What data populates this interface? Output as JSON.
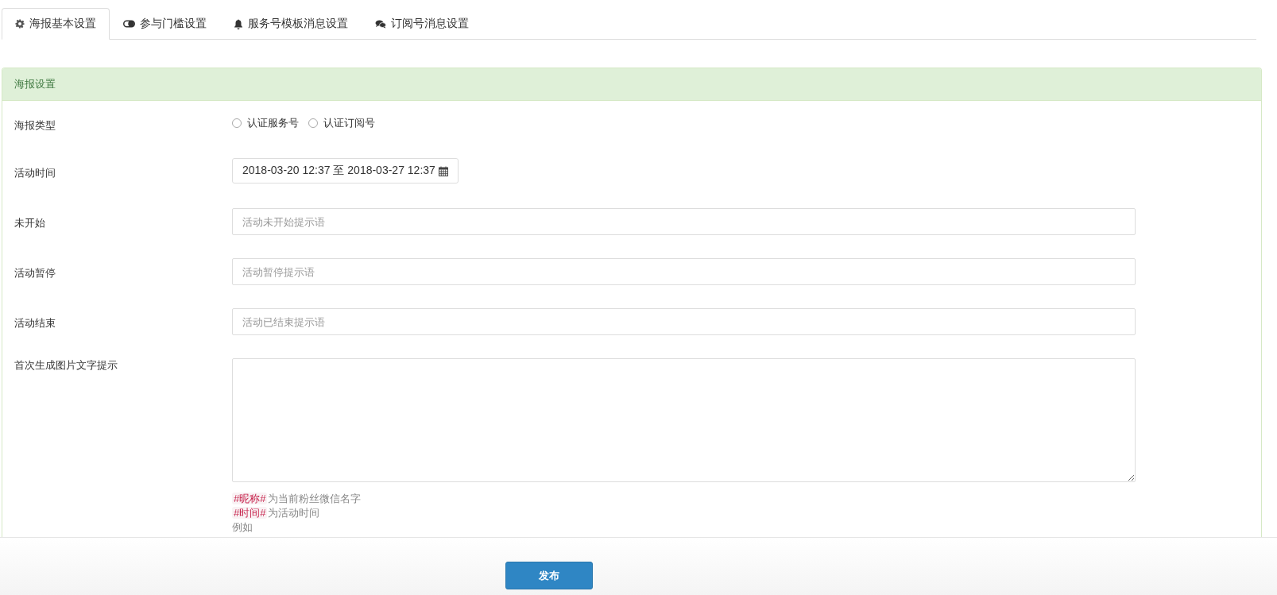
{
  "tabs": [
    {
      "label": "海报基本设置",
      "selected": true
    },
    {
      "label": "参与门槛设置",
      "selected": false
    },
    {
      "label": "服务号模板消息设置",
      "selected": false
    },
    {
      "label": "订阅号消息设置",
      "selected": false
    }
  ],
  "panel": {
    "title": "海报设置",
    "rows": [
      {
        "kind": "radio",
        "label": "海报类型",
        "options": [
          {
            "label": "认证服务号",
            "selected": false
          },
          {
            "label": "认证订阅号",
            "selected": false
          }
        ]
      },
      {
        "kind": "daterange",
        "label": "活动时间",
        "value": "2018-03-20 12:37 至 2018-03-27 12:37"
      },
      {
        "kind": "input",
        "label": "未开始",
        "placeholder": "活动未开始提示语"
      },
      {
        "kind": "input",
        "label": "活动暂停",
        "placeholder": "活动暂停提示语"
      },
      {
        "kind": "input",
        "label": "活动结束",
        "placeholder": "活动已结束提示语"
      },
      {
        "kind": "textarea",
        "label": "首次生成图片文字提示",
        "hints": [
          {
            "tag": "#昵称#",
            "text": "为当前粉丝微信名字"
          },
          {
            "tag": "#时间#",
            "text": "为活动时间"
          },
          {
            "text": "例如"
          }
        ]
      }
    ]
  },
  "footer": {
    "button": "发布"
  }
}
